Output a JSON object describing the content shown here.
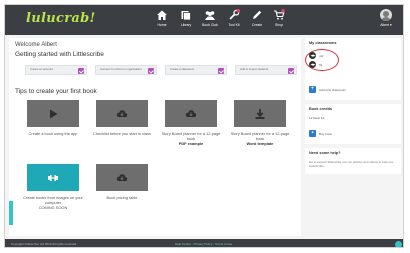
{
  "colors": {
    "topbar": "#3b3f43",
    "logo": "#b9e34a",
    "checkbox": "#b44fbf",
    "accent_blue": "#2b7bd1",
    "teal": "#1fa8b5",
    "highlight_ring": "#d6303a"
  },
  "header": {
    "logo": "lulucrab!",
    "nav": [
      {
        "label": "Home",
        "icon": "home-icon"
      },
      {
        "label": "Library",
        "icon": "library-icon"
      },
      {
        "label": "Book Club",
        "icon": "book-club-icon"
      },
      {
        "label": "Tool Kit",
        "icon": "tool-kit-icon"
      },
      {
        "label": "Create",
        "icon": "pencil-icon"
      },
      {
        "label": "Shop",
        "icon": "cart-icon"
      }
    ],
    "user_label": "Albert ▾"
  },
  "main": {
    "welcome": "Welcome Albert",
    "getting_started": "Getting started with Littlescribe",
    "steps": [
      {
        "label": "Create an account"
      },
      {
        "label": "Connect to school or organisation"
      },
      {
        "label": "Create a classroom"
      },
      {
        "label": "Add or import students"
      }
    ],
    "tips_title": "Tips to create your first book",
    "tips": [
      {
        "icon": "play-icon",
        "caption": "Create a book using the app",
        "caption_bold": ""
      },
      {
        "icon": "cloud-download-icon",
        "caption": "Checklist before you start in class",
        "caption_bold": ""
      },
      {
        "icon": "cloud-download-icon",
        "caption": "Story Board planner for a 12-page book",
        "caption_bold": "PDF example"
      },
      {
        "icon": "download-icon",
        "caption": "Story Board planner for a 12-page book",
        "caption_bold": "Word template"
      },
      {
        "icon": "dumbbell-icon",
        "caption": "Create books from images on your computer",
        "caption_bold": "COMING SOON"
      },
      {
        "icon": "cloud-download-icon",
        "caption": "Book pricing table",
        "caption_bold": ""
      }
    ]
  },
  "sidebar": {
    "classrooms": {
      "title": "My classrooms",
      "items": [
        "ubr",
        "Ta"
      ],
      "add_label": "Add new classroom"
    },
    "credits": {
      "title": "Book credits",
      "count_text": "12 Dear 10",
      "buy_label": "Buy book"
    },
    "help": {
      "title": "Need some help?",
      "text": "Go to support.littlescribe.com for articles and videos to help use LittleScribe."
    }
  },
  "footer": {
    "copyright": "Copyright Littlescribe Ltd 2019 All rights reserved",
    "links": "Help Centre · Privacy Policy · Terms of use"
  }
}
